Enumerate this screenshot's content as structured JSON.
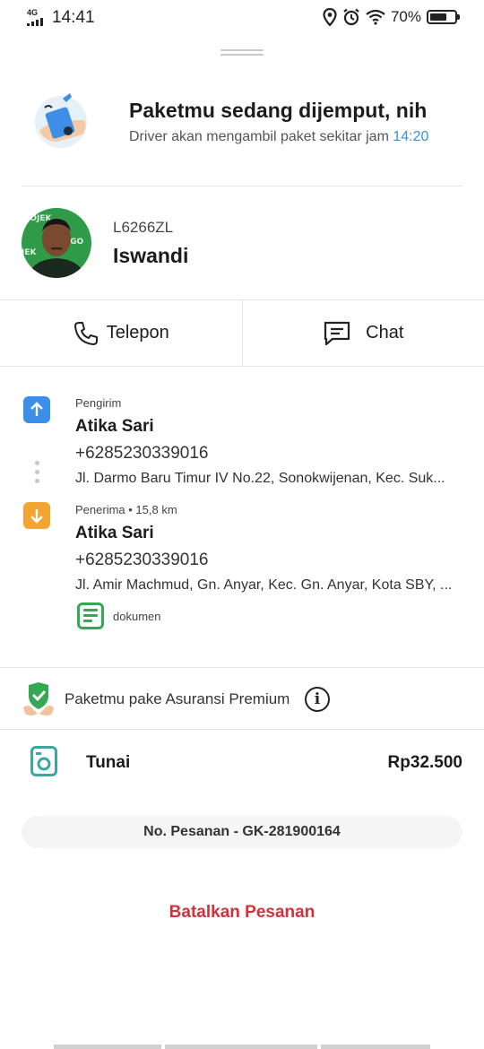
{
  "status_bar": {
    "network": "4G",
    "time": "14:41",
    "battery_percent": "70%",
    "battery_level": 0.7,
    "icons": [
      "location-icon",
      "alarm-icon",
      "wifi-icon",
      "battery-icon"
    ]
  },
  "header": {
    "title": "Paketmu sedang dijemput, nih",
    "subtitle_prefix": "Driver akan mengambil paket sekitar jam ",
    "pickup_time": "14:20"
  },
  "driver": {
    "plate": "L6266ZL",
    "name": "Iswandi",
    "avatar_jacket_text": "GOJEK"
  },
  "contact": {
    "call_label": "Telepon",
    "chat_label": "Chat"
  },
  "route": {
    "sender": {
      "label": "Pengirim",
      "name": "Atika Sari",
      "phone": "+6285230339016",
      "address": "Jl. Darmo Baru Timur IV No.22, Sonokwijenan, Kec. Suk..."
    },
    "receiver": {
      "label": "Penerima • 15,8 km",
      "name": "Atika Sari",
      "phone": "+6285230339016",
      "address": "Jl. Amir Machmud, Gn. Anyar, Kec. Gn. Anyar, Kota SBY, ..."
    },
    "item_type": "dokumen"
  },
  "insurance": {
    "text": "Paketmu pake Asuransi Premium"
  },
  "payment": {
    "method": "Tunai",
    "amount": "Rp32.500"
  },
  "order": {
    "number": "No. Pesanan - GK-281900164"
  },
  "actions": {
    "cancel_label": "Batalkan Pesanan"
  },
  "colors": {
    "accent_blue": "#3d8fd8",
    "pickup_blue": "#3d8ee6",
    "dropoff_orange": "#f2a532",
    "doc_green": "#34a853",
    "cash_teal": "#3aa89c",
    "cancel_red": "#d0323c"
  }
}
